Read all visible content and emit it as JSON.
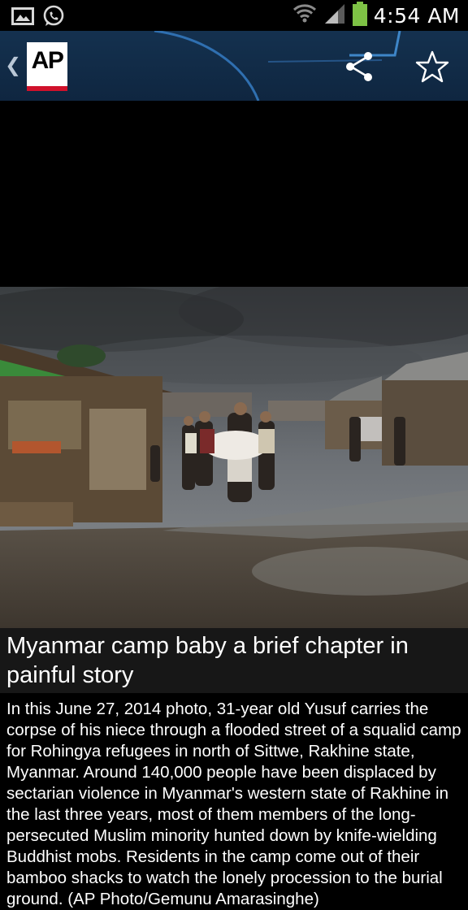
{
  "status_bar": {
    "time": "4:54 AM",
    "left_icons": [
      "image-icon",
      "whatsapp-icon"
    ],
    "right_icons": [
      "wifi-icon",
      "signal-icon",
      "battery-icon"
    ],
    "battery_color": "#7ec245"
  },
  "app_bar": {
    "logo_text": "AP",
    "logo_accent": "#d0112b",
    "background": "#14314f",
    "back_icon": "chevron-left-icon",
    "actions": [
      "share-icon",
      "star-icon"
    ]
  },
  "article": {
    "headline": "Myanmar camp baby a brief chapter in painful story",
    "caption": "In this June 27, 2014 photo, 31-year old Yusuf carries the corpse of his niece through a flooded street of a squalid camp for Rohingya refugees in north of Sittwe, Rakhine state, Myanmar. Around 140,000 people have been displaced by sectarian violence in Myanmar's western state of Rakhine in the last three years, most of them members of the long-persecuted Muslim minority hunted down by knife-wielding Buddhist mobs. Residents in the camp come out of their bamboo shacks to watch the lonely procession to the burial ground. (AP Photo/Gemunu Amarasinghe)"
  }
}
